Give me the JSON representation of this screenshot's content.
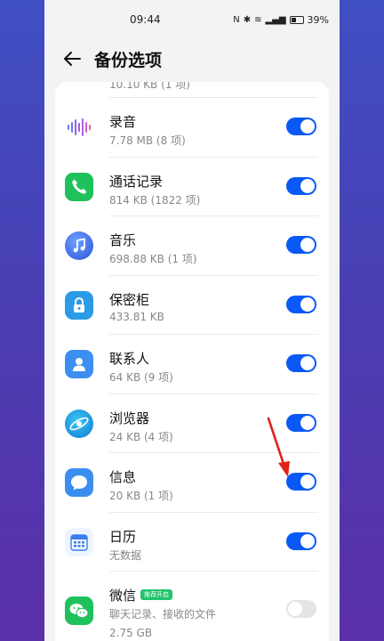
{
  "status": {
    "time": "09:44",
    "battery": "39%"
  },
  "header": {
    "title": "备份选项"
  },
  "cutoff_text": "10.10 KB (1 项)",
  "items": [
    {
      "name": "录音",
      "sub": "7.78 MB (8 项)",
      "icon": "voice-recorder-icon",
      "on": true
    },
    {
      "name": "通话记录",
      "sub": "814 KB (1822 项)",
      "icon": "phone-icon",
      "on": true
    },
    {
      "name": "音乐",
      "sub": "698.88 KB (1 项)",
      "icon": "music-icon",
      "on": true
    },
    {
      "name": "保密柜",
      "sub": "433.81 KB",
      "icon": "safe-lock-icon",
      "on": true
    },
    {
      "name": "联系人",
      "sub": "64 KB (9 项)",
      "icon": "contacts-icon",
      "on": true
    },
    {
      "name": "浏览器",
      "sub": "24 KB (4 项)",
      "icon": "browser-icon",
      "on": true
    },
    {
      "name": "信息",
      "sub": "20 KB (1 项)",
      "icon": "messages-icon",
      "on": true
    },
    {
      "name": "日历",
      "sub": "无数据",
      "icon": "calendar-icon",
      "on": true
    }
  ],
  "wechat": {
    "name": "微信",
    "badge": "推荐开启",
    "sub": "聊天记录、接收的文件",
    "size": "2.75 GB",
    "icon": "wechat-icon",
    "on": false
  },
  "colors": {
    "accent": "#0a59f7",
    "badge": "#23c36b",
    "annotation": "#e0201b"
  }
}
